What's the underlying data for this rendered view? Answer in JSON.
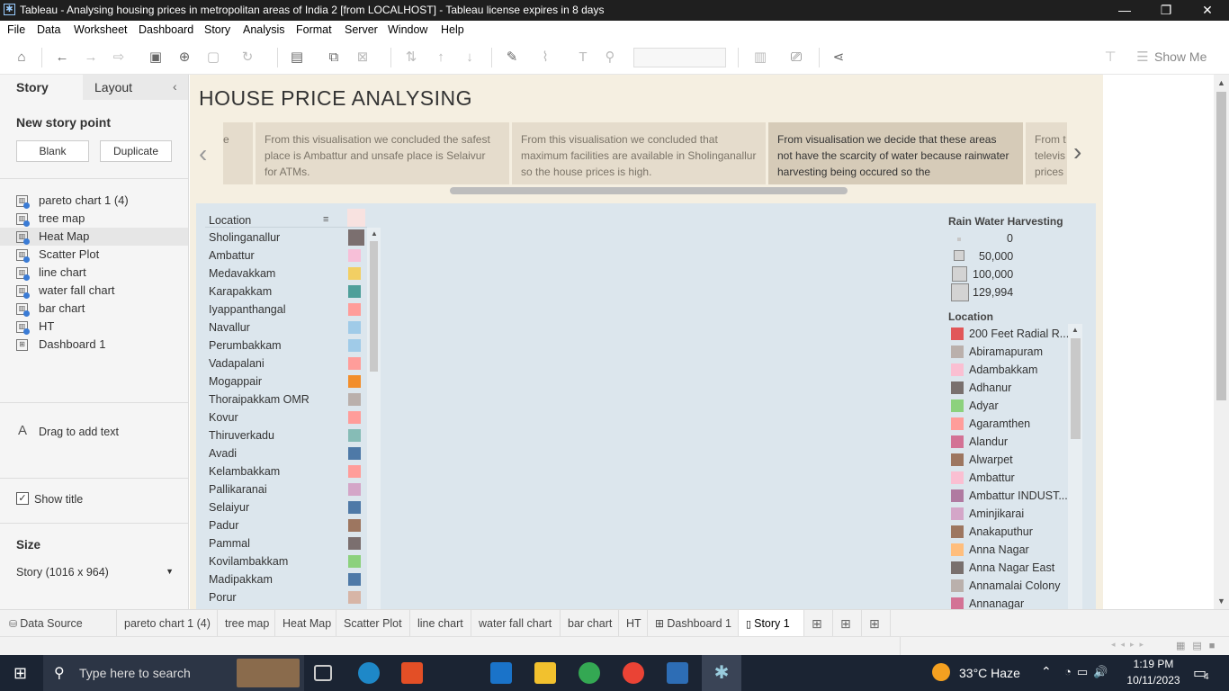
{
  "window": {
    "title": "Tableau - Analysing housing prices in metropolitan areas of India 2 [from LOCALHOST] - Tableau license expires in 8 days"
  },
  "menu": [
    "File",
    "Data",
    "Worksheet",
    "Dashboard",
    "Story",
    "Analysis",
    "Format",
    "Server",
    "Window",
    "Help"
  ],
  "toolbar": {
    "show_me": "Show Me"
  },
  "left_panel": {
    "tab_story": "Story",
    "tab_layout": "Layout",
    "new_story_point": "New story point",
    "blank": "Blank",
    "duplicate": "Duplicate",
    "sheets": [
      "pareto chart 1 (4)",
      "tree map",
      "Heat Map",
      "Scatter Plot",
      "line chart",
      "water fall chart",
      "bar chart",
      "HT",
      "Dashboard 1"
    ],
    "drag_text": "Drag to add text",
    "show_title": "Show title",
    "size_heading": "Size",
    "size_value": "Story (1016 x 964)"
  },
  "story": {
    "title": "HOUSE PRICE ANALYSING",
    "points": [
      "e",
      "From this visualisation we concluded the safest place is Ambattur and unsafe place is Selaivur for ATMs.",
      "From this visualisation we concluded that maximum facilities are available in Sholinganallur so the house prices is high.",
      "From visualisation we decide that these areas not have the scarcity of water because rainwater harvesting being occured so the",
      "From t televis prices"
    ]
  },
  "viz": {
    "location_header": "Location",
    "rows": [
      {
        "name": "Sholinganallur",
        "color": "#7b6f6f"
      },
      {
        "name": "Ambattur",
        "color": "#f7bfd8"
      },
      {
        "name": "Medavakkam",
        "color": "#f2cf63"
      },
      {
        "name": "Karapakkam",
        "color": "#4e9f9a"
      },
      {
        "name": "Iyappanthangal",
        "color": "#ff9d9a"
      },
      {
        "name": "Navallur",
        "color": "#a0cbe8"
      },
      {
        "name": "Perumbakkam",
        "color": "#a0cbe8"
      },
      {
        "name": "Vadapalani",
        "color": "#ff9d9a"
      },
      {
        "name": "Mogappair",
        "color": "#f28e2b"
      },
      {
        "name": "Thoraipakkam OMR",
        "color": "#bab0ac"
      },
      {
        "name": "Kovur",
        "color": "#ff9d9a"
      },
      {
        "name": "Thiruverkadu",
        "color": "#86bcb6"
      },
      {
        "name": "Avadi",
        "color": "#4e79a7"
      },
      {
        "name": "Kelambakkam",
        "color": "#ff9d9a"
      },
      {
        "name": "Pallikaranai",
        "color": "#d4a6c8"
      },
      {
        "name": "Selaiyur",
        "color": "#4e79a7"
      },
      {
        "name": "Padur",
        "color": "#9d7660"
      },
      {
        "name": "Pammal",
        "color": "#7b6f6f"
      },
      {
        "name": "Kovilambakkam",
        "color": "#8cd17d"
      },
      {
        "name": "Madipakkam",
        "color": "#4e79a7"
      },
      {
        "name": "Porur",
        "color": "#d7b5a6"
      }
    ],
    "size_legend": {
      "title": "Rain Water Harvesting",
      "items": [
        "0",
        "50,000",
        "100,000",
        "129,994"
      ]
    },
    "color_legend": {
      "title": "Location",
      "items": [
        {
          "name": "200 Feet Radial R...",
          "color": "#e15759"
        },
        {
          "name": "Abiramapuram",
          "color": "#bab0ac"
        },
        {
          "name": "Adambakkam",
          "color": "#fabfd2"
        },
        {
          "name": "Adhanur",
          "color": "#79706e"
        },
        {
          "name": "Adyar",
          "color": "#8cd17d"
        },
        {
          "name": "Agaramthen",
          "color": "#ff9d9a"
        },
        {
          "name": "Alandur",
          "color": "#d37295"
        },
        {
          "name": "Alwarpet",
          "color": "#9d7660"
        },
        {
          "name": "Ambattur",
          "color": "#fabfd2"
        },
        {
          "name": "Ambattur INDUST...",
          "color": "#b07aa1"
        },
        {
          "name": "Aminjikarai",
          "color": "#d4a6c8"
        },
        {
          "name": "Anakaputhur",
          "color": "#9d7660"
        },
        {
          "name": "Anna Nagar",
          "color": "#ffbe7d"
        },
        {
          "name": "Anna Nagar East",
          "color": "#79706e"
        },
        {
          "name": "Annamalai Colony",
          "color": "#bab0ac"
        },
        {
          "name": "Annanagar",
          "color": "#d37295"
        }
      ]
    }
  },
  "bottom_tabs": [
    "Data Source",
    "pareto chart 1 (4)",
    "tree map",
    "Heat Map",
    "Scatter Plot",
    "line chart",
    "water fall chart",
    "bar chart",
    "HT",
    "Dashboard 1",
    "Story 1"
  ],
  "taskbar": {
    "search": "Type here to search",
    "weather": "33°C  Haze",
    "time": "1:19 PM",
    "date": "10/11/2023",
    "notifications": "4"
  }
}
